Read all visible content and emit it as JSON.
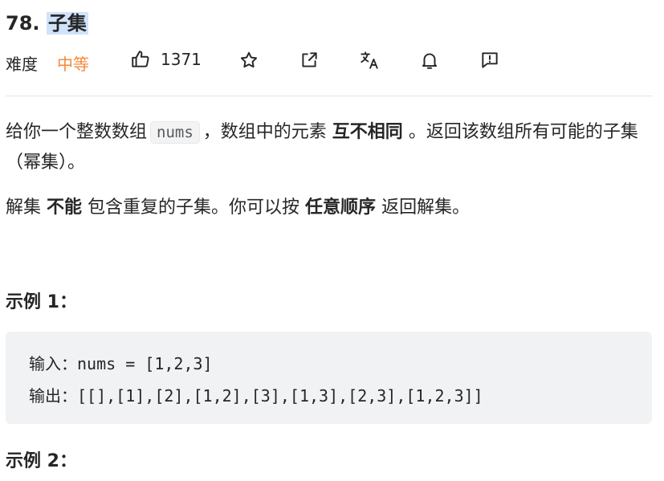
{
  "problem": {
    "number": "78.",
    "title": "子集",
    "difficulty_label": "难度",
    "difficulty": "中等",
    "likes": "1371"
  },
  "actions": {
    "icons": [
      "thumbs-up-icon",
      "star-icon",
      "share-icon",
      "translate-icon",
      "bell-icon",
      "feedback-icon"
    ]
  },
  "description": {
    "p1_a": "给你一个整数数组",
    "p1_code": "nums",
    "p1_b": "，数组中的元素",
    "p1_bold": "互不相同",
    "p1_c": "。返回该数组所有可能的子集（幂集）。",
    "p2_a": "解集",
    "p2_bold1": "不能",
    "p2_b": "包含重复的子集。你可以按",
    "p2_bold2": "任意顺序",
    "p2_c": "返回解集。"
  },
  "examples": {
    "ex1_title": "示例 1：",
    "ex1_input": "输入：nums = [1,2,3]",
    "ex1_output": "输出：[[],[1],[2],[1,2],[3],[1,3],[2,3],[1,2,3]]",
    "ex2_title": "示例 2："
  },
  "colors": {
    "difficulty": "#f6883a",
    "title_highlight": "#cfe3fb",
    "code_bg": "#f1f2f4"
  }
}
